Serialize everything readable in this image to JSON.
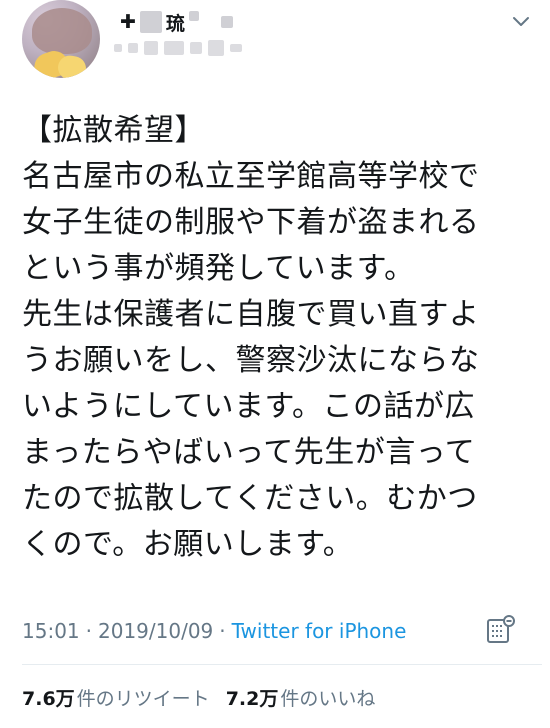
{
  "tweet": {
    "author": {
      "name_visible_char": "琉"
    },
    "text": "【拡散希望】\n名古屋市の私立至学館高等学校で\n女子生徒の制服や下着が盗まれる\nという事が頻発しています。\n先生は保護者に自腹で買い直すよ\nうお願いをし、警察沙汰にならな\nいようにしています。この話が広\nまったらやばいって先生が言って\nたので拡散してください。むかつ\nくので。お願いします。",
    "time": "15:01",
    "date": "2019/10/09",
    "separator": "·",
    "source": "Twitter for iPhone",
    "stats": {
      "retweets_count": "7.6万",
      "retweets_label": "件のリツイート",
      "likes_count": "7.2万",
      "likes_label": "件のいいね"
    }
  },
  "icons": {
    "menu": "chevron-down-icon",
    "analytics": "tweet-analytics-icon"
  },
  "colors": {
    "text": "#14171a",
    "secondary": "#657786",
    "link": "#1b95e0",
    "divider": "#e6ecf0"
  }
}
